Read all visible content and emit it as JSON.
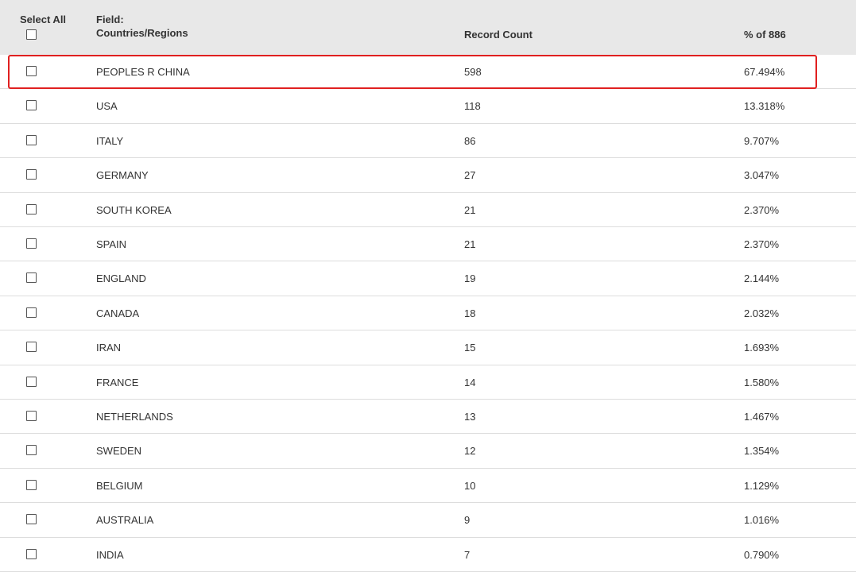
{
  "header": {
    "select_all_label": "Select All",
    "field_label_line1": "Field:",
    "field_label_line2": "Countries/Regions",
    "record_count_label": "Record Count",
    "percent_label": "% of 886"
  },
  "highlight_color": "#e02020",
  "rows": [
    {
      "country": "PEOPLES R CHINA",
      "count": "598",
      "percent": "67.494%",
      "highlighted": true
    },
    {
      "country": "USA",
      "count": "118",
      "percent": "13.318%"
    },
    {
      "country": "ITALY",
      "count": "86",
      "percent": "9.707%"
    },
    {
      "country": "GERMANY",
      "count": "27",
      "percent": "3.047%"
    },
    {
      "country": "SOUTH KOREA",
      "count": "21",
      "percent": "2.370%"
    },
    {
      "country": "SPAIN",
      "count": "21",
      "percent": "2.370%"
    },
    {
      "country": "ENGLAND",
      "count": "19",
      "percent": "2.144%"
    },
    {
      "country": "CANADA",
      "count": "18",
      "percent": "2.032%"
    },
    {
      "country": "IRAN",
      "count": "15",
      "percent": "1.693%"
    },
    {
      "country": "FRANCE",
      "count": "14",
      "percent": "1.580%"
    },
    {
      "country": "NETHERLANDS",
      "count": "13",
      "percent": "1.467%"
    },
    {
      "country": "SWEDEN",
      "count": "12",
      "percent": "1.354%"
    },
    {
      "country": "BELGIUM",
      "count": "10",
      "percent": "1.129%"
    },
    {
      "country": "AUSTRALIA",
      "count": "9",
      "percent": "1.016%"
    },
    {
      "country": "INDIA",
      "count": "7",
      "percent": "0.790%"
    }
  ]
}
